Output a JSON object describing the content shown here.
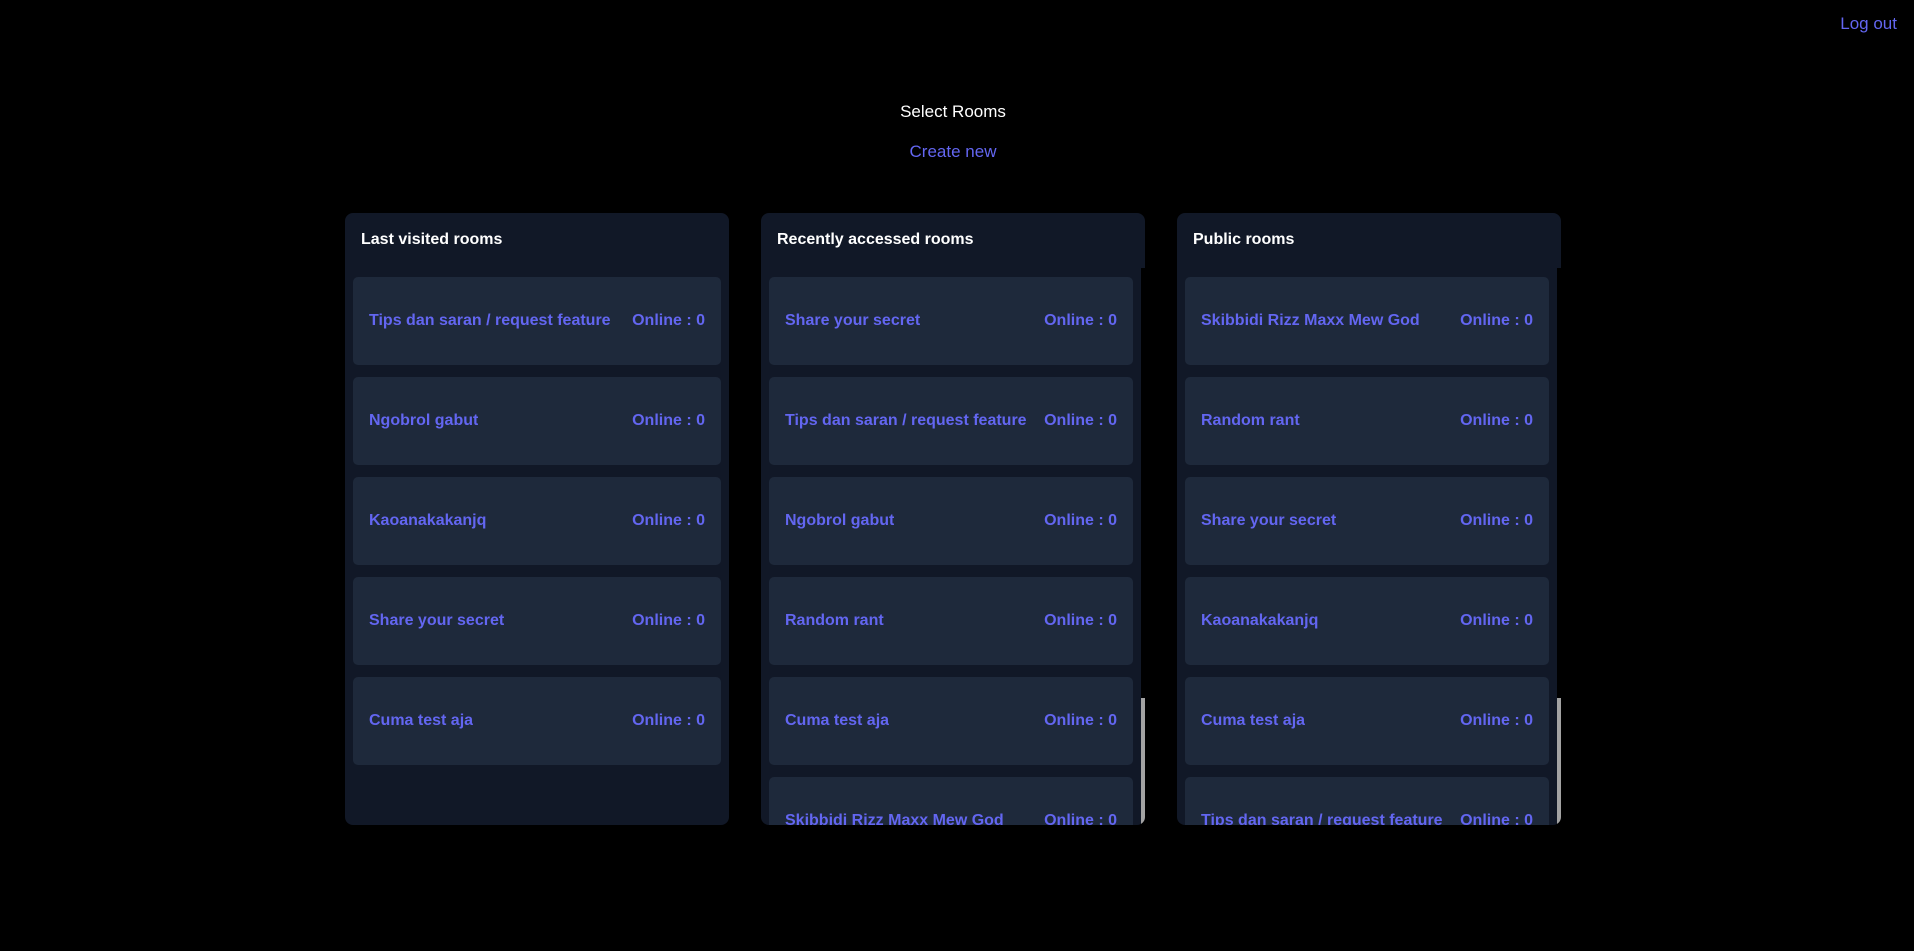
{
  "header": {
    "logout_label": "Log out",
    "title": "Select Rooms",
    "create_label": "Create new"
  },
  "columns": [
    {
      "title": "Last visited rooms",
      "rooms": [
        {
          "name": "Tips dan saran / request feature",
          "online": "Online : 0"
        },
        {
          "name": "Ngobrol gabut",
          "online": "Online : 0"
        },
        {
          "name": "Kaoanakakanjq",
          "online": "Online : 0"
        },
        {
          "name": "Share your secret",
          "online": "Online : 0"
        },
        {
          "name": "Cuma test aja",
          "online": "Online : 0"
        }
      ]
    },
    {
      "title": "Recently accessed rooms",
      "rooms": [
        {
          "name": "Share your secret",
          "online": "Online : 0"
        },
        {
          "name": "Tips dan saran / request feature",
          "online": "Online : 0"
        },
        {
          "name": "Ngobrol gabut",
          "online": "Online : 0"
        },
        {
          "name": "Random rant",
          "online": "Online : 0"
        },
        {
          "name": "Cuma test aja",
          "online": "Online : 0"
        },
        {
          "name": "Skibbidi Rizz Maxx Mew God",
          "online": "Online : 0"
        }
      ]
    },
    {
      "title": "Public rooms",
      "rooms": [
        {
          "name": "Skibbidi Rizz Maxx Mew God",
          "online": "Online : 0"
        },
        {
          "name": "Random rant",
          "online": "Online : 0"
        },
        {
          "name": "Share your secret",
          "online": "Online : 0"
        },
        {
          "name": "Kaoanakakanjq",
          "online": "Online : 0"
        },
        {
          "name": "Cuma test aja",
          "online": "Online : 0"
        },
        {
          "name": "Tips dan saran / request feature",
          "online": "Online : 0"
        }
      ]
    }
  ],
  "colors": {
    "background": "#000000",
    "panel": "#111827",
    "card": "#1e293b",
    "accent": "#6366f1"
  }
}
